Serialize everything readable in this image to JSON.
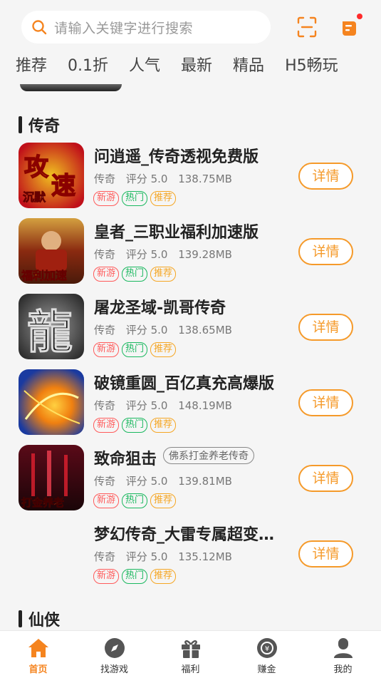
{
  "search": {
    "placeholder": "请输入关键字进行搜索"
  },
  "tabs": [
    "推荐",
    "0.1折",
    "人气",
    "最新",
    "精品",
    "H5畅玩"
  ],
  "sections": [
    {
      "title": "传奇"
    },
    {
      "title": "仙侠"
    }
  ],
  "badges": {
    "new": "新游",
    "hot": "热门",
    "rec": "推荐"
  },
  "detail_label": "详情",
  "games": [
    {
      "name": "问逍遥_传奇透视免费版",
      "category": "传奇",
      "rating": "评分 5.0",
      "size": "138.75MB",
      "icon_text": "攻速",
      "icon_text2": "沉默",
      "icon_colors": [
        "#c0101a",
        "#f0c020"
      ]
    },
    {
      "name": "皇者_三职业福利加速版",
      "category": "传奇",
      "rating": "评分 5.0",
      "size": "139.28MB",
      "icon_text": "福利加速",
      "icon_colors": [
        "#4a1a0a",
        "#d4a040"
      ]
    },
    {
      "name": "屠龙圣域-凯哥传奇",
      "category": "传奇",
      "rating": "评分 5.0",
      "size": "138.65MB",
      "icon_text": "龍",
      "icon_colors": [
        "#3a3a3a",
        "#9a9a9a"
      ]
    },
    {
      "name": "破镜重圆_百亿真充高爆版",
      "category": "传奇",
      "rating": "评分 5.0",
      "size": "148.19MB",
      "icon_colors": [
        "#1a3aa0",
        "#f08010"
      ]
    },
    {
      "name": "致命狙击",
      "subtag": "佛系打金养老传奇",
      "category": "传奇",
      "rating": "评分 5.0",
      "size": "139.81MB",
      "icon_text": "打金养老",
      "icon_colors": [
        "#2a0a10",
        "#c01020"
      ]
    },
    {
      "name": "梦幻传奇_大雷专属超变福利版",
      "category": "传奇",
      "rating": "评分 5.0",
      "size": "135.12MB"
    }
  ],
  "nav": [
    {
      "label": "首页",
      "icon": "home-icon",
      "active": true
    },
    {
      "label": "找游戏",
      "icon": "compass-icon"
    },
    {
      "label": "福利",
      "icon": "gift-icon"
    },
    {
      "label": "赚金",
      "icon": "coin-icon"
    },
    {
      "label": "我的",
      "icon": "user-icon"
    }
  ],
  "colors": {
    "accent": "#f5841f",
    "detail": "#f59a2a",
    "new": "#ff5b5b",
    "hot": "#1ab85f",
    "rec": "#f5a623"
  }
}
